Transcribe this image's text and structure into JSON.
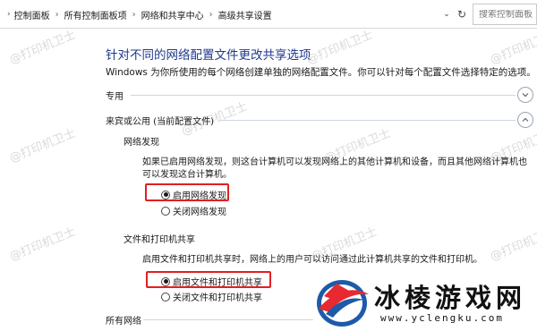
{
  "breadcrumb": {
    "items": [
      "控制面板",
      "所有控制面板项",
      "网络和共享中心",
      "高级共享设置"
    ],
    "separator": "›"
  },
  "search": {
    "placeholder": "搜索控制面板"
  },
  "page": {
    "title": "针对不同的网络配置文件更改共享选项",
    "description": "Windows 为你所使用的每个网络创建单独的网络配置文件。你可以针对每个配置文件选择特定的选项。"
  },
  "sections": {
    "private": {
      "label": "专用",
      "state": "collapsed"
    },
    "guest_public": {
      "label": "来宾或公用 (当前配置文件)",
      "state": "expanded"
    },
    "all_networks": {
      "label": "所有网络"
    }
  },
  "network_discovery": {
    "heading": "网络发现",
    "description": "如果已启用网络发现，则这台计算机可以发现网络上的其他计算机和设备，而且其他网络计算机也可以发现这台计算机。",
    "options": [
      {
        "label": "启用网络发现",
        "selected": true
      },
      {
        "label": "关闭网络发现",
        "selected": false
      }
    ]
  },
  "file_printer_sharing": {
    "heading": "文件和打印机共享",
    "description": "启用文件和打印机共享时，网络上的用户可以访问通过此计算机共享的文件和打印机。",
    "options": [
      {
        "label": "启用文件和打印机共享",
        "selected": true
      },
      {
        "label": "关闭文件和打印机共享",
        "selected": false
      }
    ]
  },
  "watermark": "@打印机卫士",
  "logo": {
    "name": "冰棱游戏网",
    "url": "www.yclengku.com"
  },
  "colors": {
    "title": "#1e3a8a",
    "highlight": "#e02020",
    "logo_red": "#e8292f",
    "logo_blue": "#1e5aa8"
  }
}
